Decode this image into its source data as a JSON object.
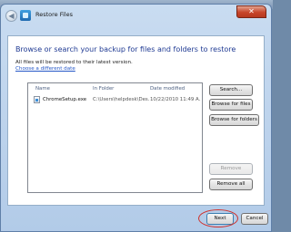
{
  "window": {
    "title": "Restore Files",
    "close_label": "✕"
  },
  "content": {
    "heading": "Browse or search your backup for files and folders to restore",
    "subtext": "All files will be restored to their latest version.",
    "date_link": "Choose a different date"
  },
  "file_list": {
    "columns": [
      "Name",
      "In Folder",
      "Date modified"
    ],
    "rows": [
      {
        "name": "ChromeSetup.exe",
        "folder": "C:\\Users\\helpdesk\\Des...",
        "date": "10/22/2010 11:49 A..."
      }
    ]
  },
  "side_buttons": {
    "search": "Search...",
    "browse_files": "Browse for files",
    "browse_folders": "Browse for folders",
    "remove": "Remove",
    "remove_all": "Remove all"
  },
  "footer": {
    "next": "Next",
    "cancel": "Cancel"
  }
}
